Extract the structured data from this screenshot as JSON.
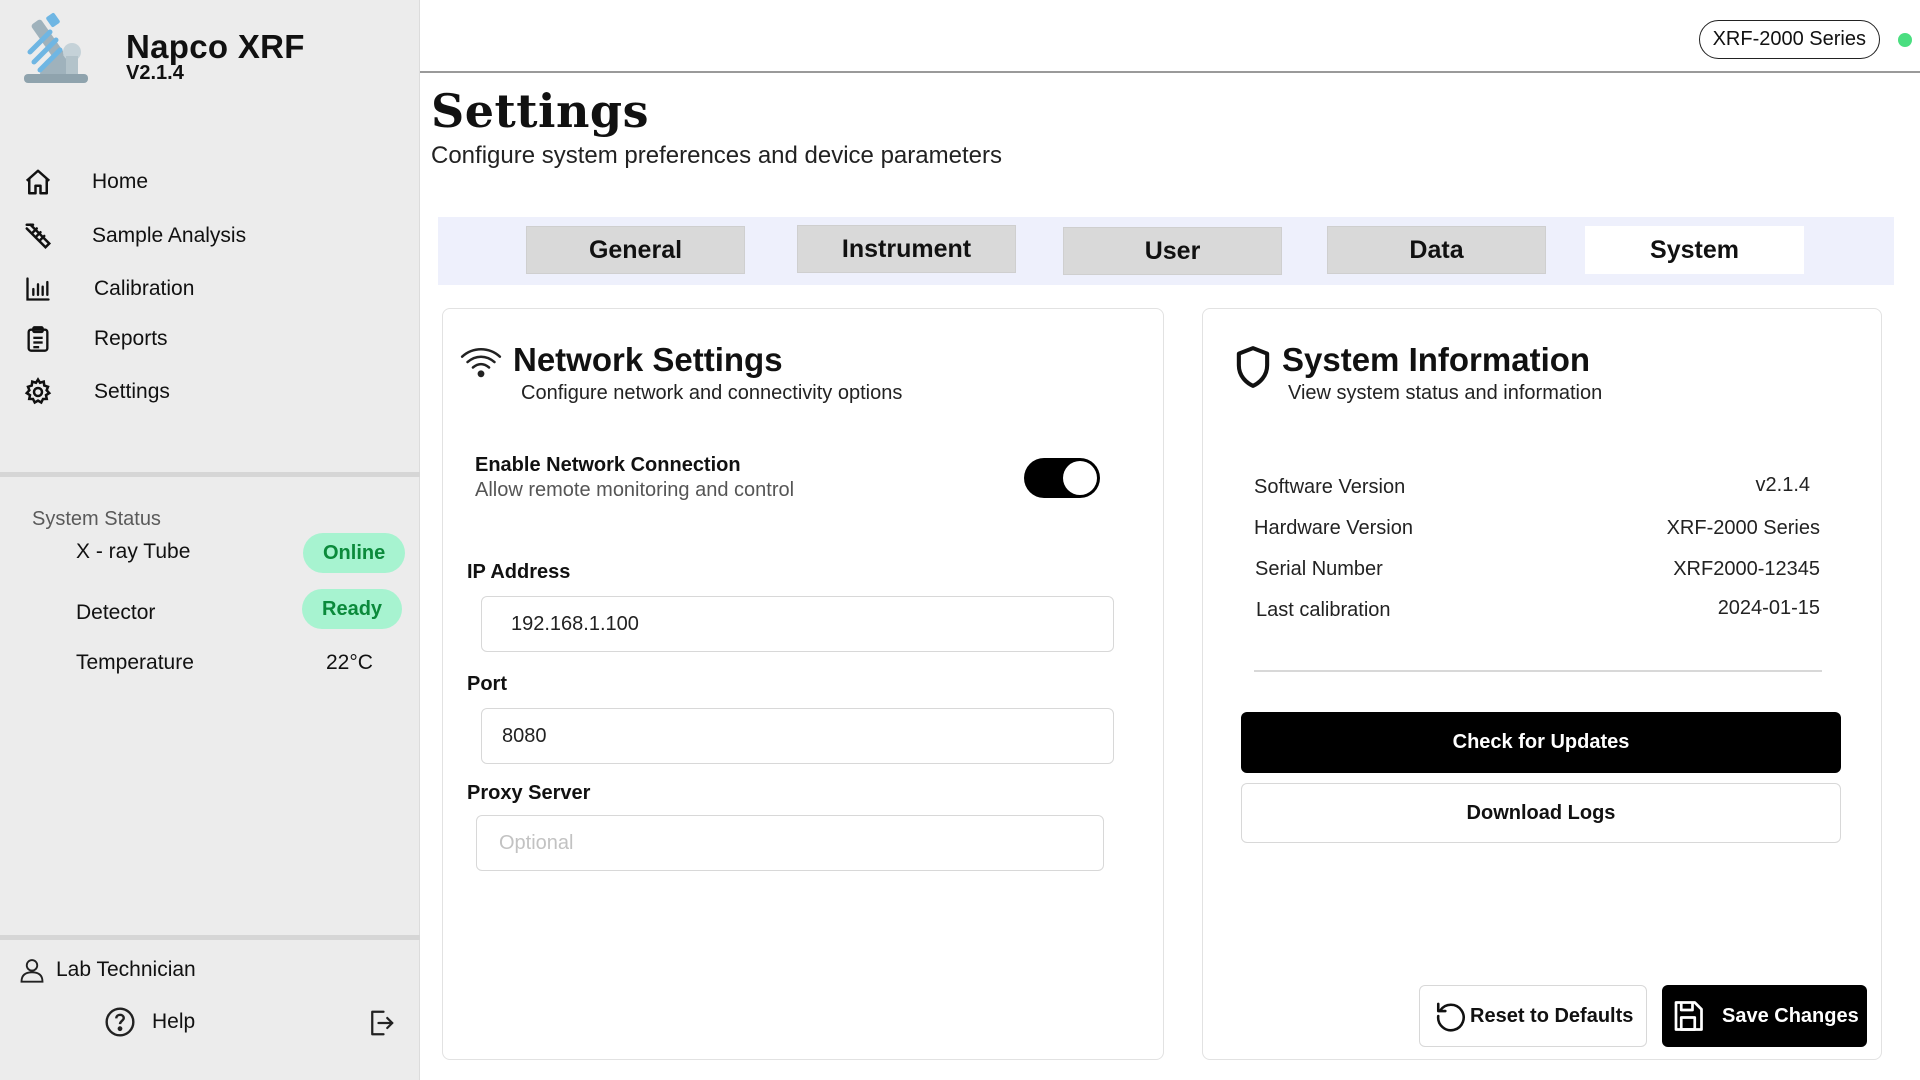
{
  "app": {
    "name": "Napco  XRF",
    "version": "V2.1.4",
    "logo_icon": "microscope-icon"
  },
  "sidebar": {
    "nav": [
      {
        "label": "Home",
        "icon": "home-icon"
      },
      {
        "label": "Sample Analysis",
        "icon": "test-tube-icon"
      },
      {
        "label": "Calibration",
        "icon": "bar-chart-icon"
      },
      {
        "label": "Reports",
        "icon": "clipboard-icon"
      },
      {
        "label": "Settings",
        "icon": "gear-icon"
      }
    ],
    "status": {
      "heading": "System Status",
      "xray_label": "X - ray Tube",
      "xray_value": "Online",
      "detector_label": "Detector",
      "detector_value": "Ready",
      "temperature_label": "Temperature",
      "temperature_value": "22°C"
    },
    "user": "Lab Technician",
    "help": "Help"
  },
  "header": {
    "device_series": "XRF-2000 Series",
    "connection_status_color": "#4ade80"
  },
  "page": {
    "title": "Settings",
    "subtitle": "Configure system preferences and device parameters"
  },
  "tabs": [
    {
      "label": "General",
      "active": false
    },
    {
      "label": "Instrument",
      "active": false
    },
    {
      "label": "User",
      "active": false
    },
    {
      "label": "Data",
      "active": false
    },
    {
      "label": "System",
      "active": true
    }
  ],
  "network": {
    "title": "Network Settings",
    "subtitle": "Configure network and connectivity options",
    "enable_title": "Enable Network Connection",
    "enable_sub": "Allow remote monitoring and control",
    "enabled": true,
    "ip_label": "IP Address",
    "ip_value": "192.168.1.100",
    "port_label": "Port",
    "port_value": "8080",
    "proxy_label": "Proxy Server",
    "proxy_value": "",
    "proxy_placeholder": "Optional"
  },
  "system_info": {
    "title": "System Information",
    "subtitle": "View system status and information",
    "rows": [
      {
        "label": "Software Version",
        "value": "v2.1.4"
      },
      {
        "label": "Hardware Version",
        "value": "XRF-2000 Series"
      },
      {
        "label": "Serial Number",
        "value": "XRF2000-12345"
      },
      {
        "label": "Last calibration",
        "value": "2024-01-15"
      }
    ],
    "check_updates": "Check for Updates",
    "download_logs": "Download Logs"
  },
  "actions": {
    "reset": "Reset to Defaults",
    "save": "Save Changes"
  },
  "colors": {
    "accent": "#000000",
    "badge_bg": "#a7f3d0",
    "badge_text": "#0b8a3b",
    "tabbar_bg": "#eef0fc"
  }
}
